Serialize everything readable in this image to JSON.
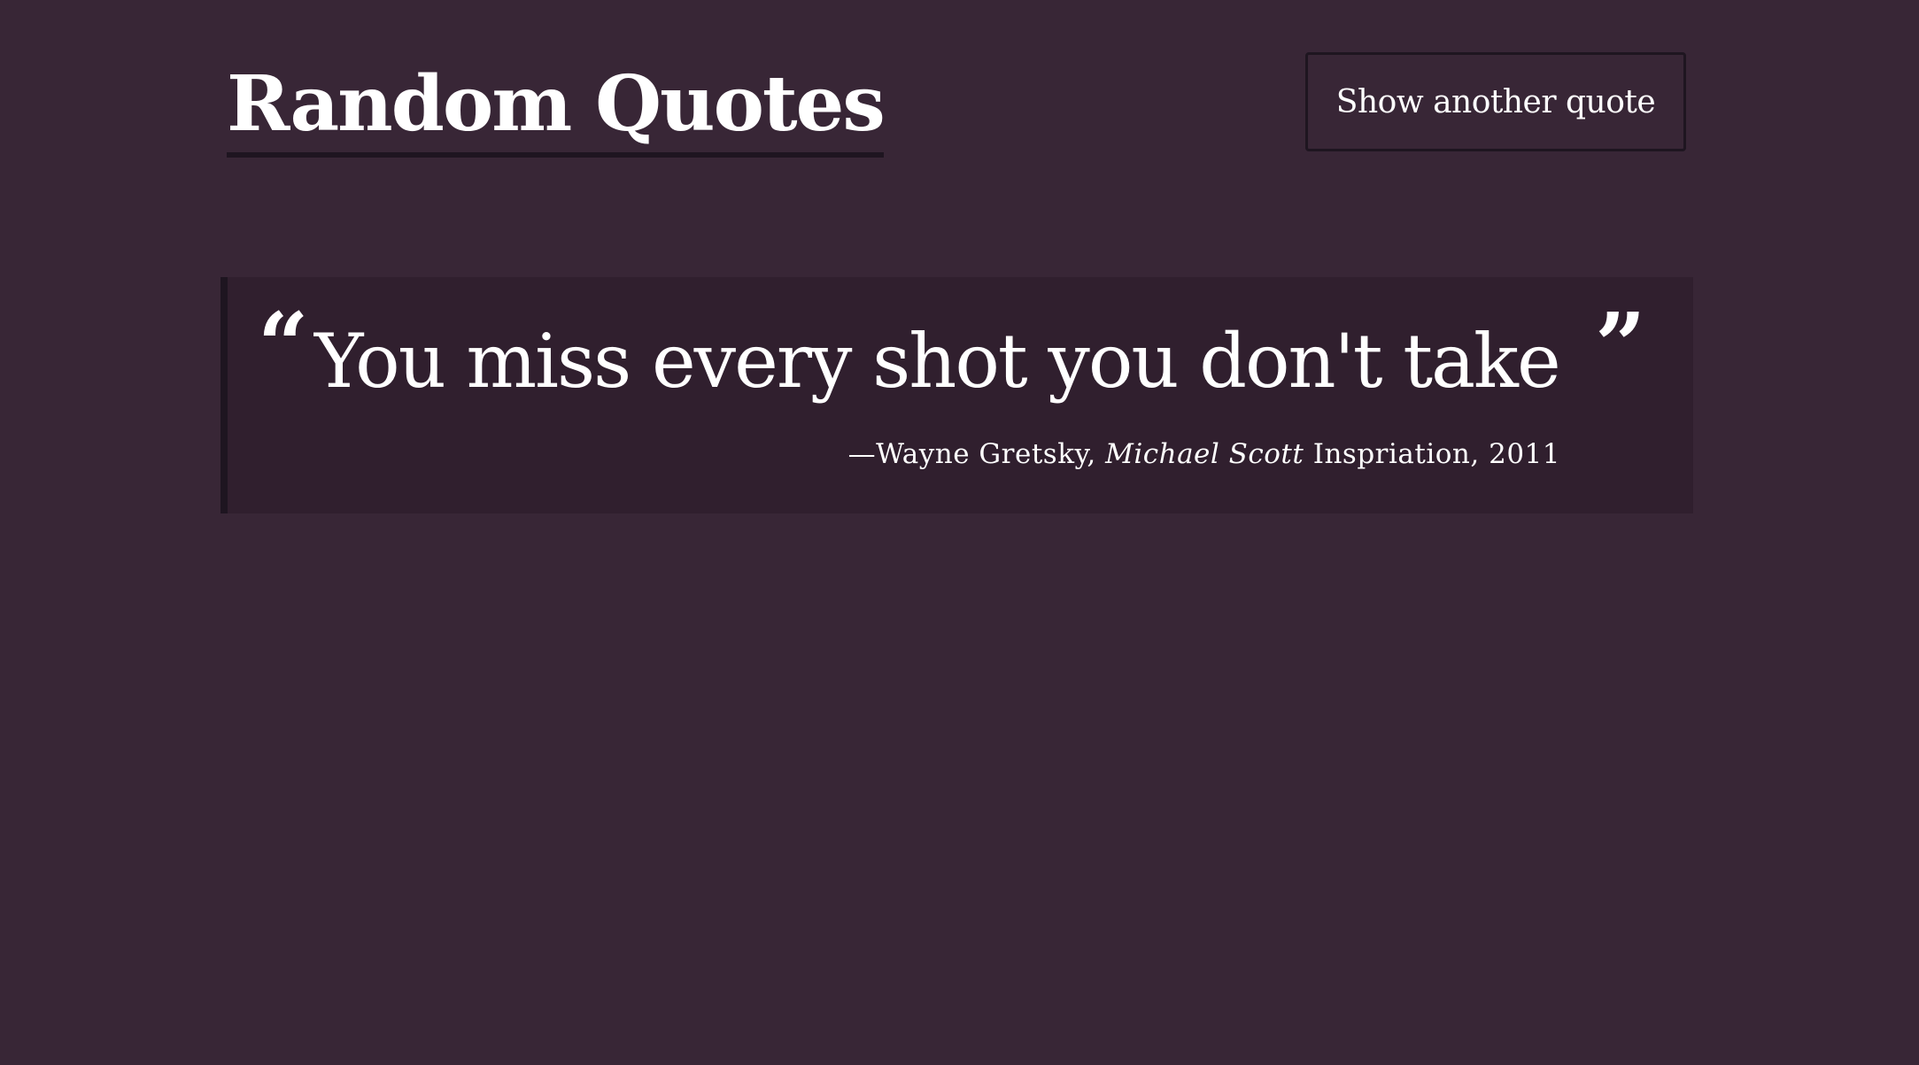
{
  "header": {
    "title": "Random Quotes",
    "button_label": "Show another quote"
  },
  "quote": {
    "open_mark": "“",
    "text": "You miss every shot you don't take",
    "close_mark": "”",
    "attribution": {
      "dash_author": "—Wayne Gretsky, ",
      "source": "Michael Scott",
      "suffix": " Inspriation, 2011"
    }
  },
  "colors": {
    "background": "#382636",
    "quote_background": "#301f2e",
    "border": "#1e1520",
    "text": "#ffffff"
  }
}
